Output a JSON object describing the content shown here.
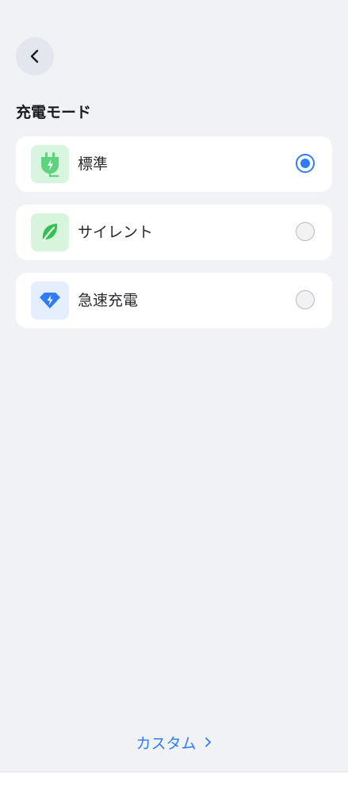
{
  "header": {
    "back_icon": "chevron-left-icon"
  },
  "section": {
    "title": "充電モード"
  },
  "modes": [
    {
      "label": "標準",
      "icon": "plug-icon",
      "selected": true
    },
    {
      "label": "サイレント",
      "icon": "leaf-icon",
      "selected": false
    },
    {
      "label": "急速充電",
      "icon": "bolt-gem-icon",
      "selected": false
    }
  ],
  "footer": {
    "custom_label": "カスタム",
    "chevron_icon": "chevron-right-icon"
  },
  "colors": {
    "accent": "#2f7cf6",
    "background": "#f1f2f6",
    "card": "#ffffff",
    "standard_icon_bg": "#d8f5df",
    "silent_icon_bg": "#d6f5dc",
    "fast_icon_bg": "#e4eefc"
  }
}
